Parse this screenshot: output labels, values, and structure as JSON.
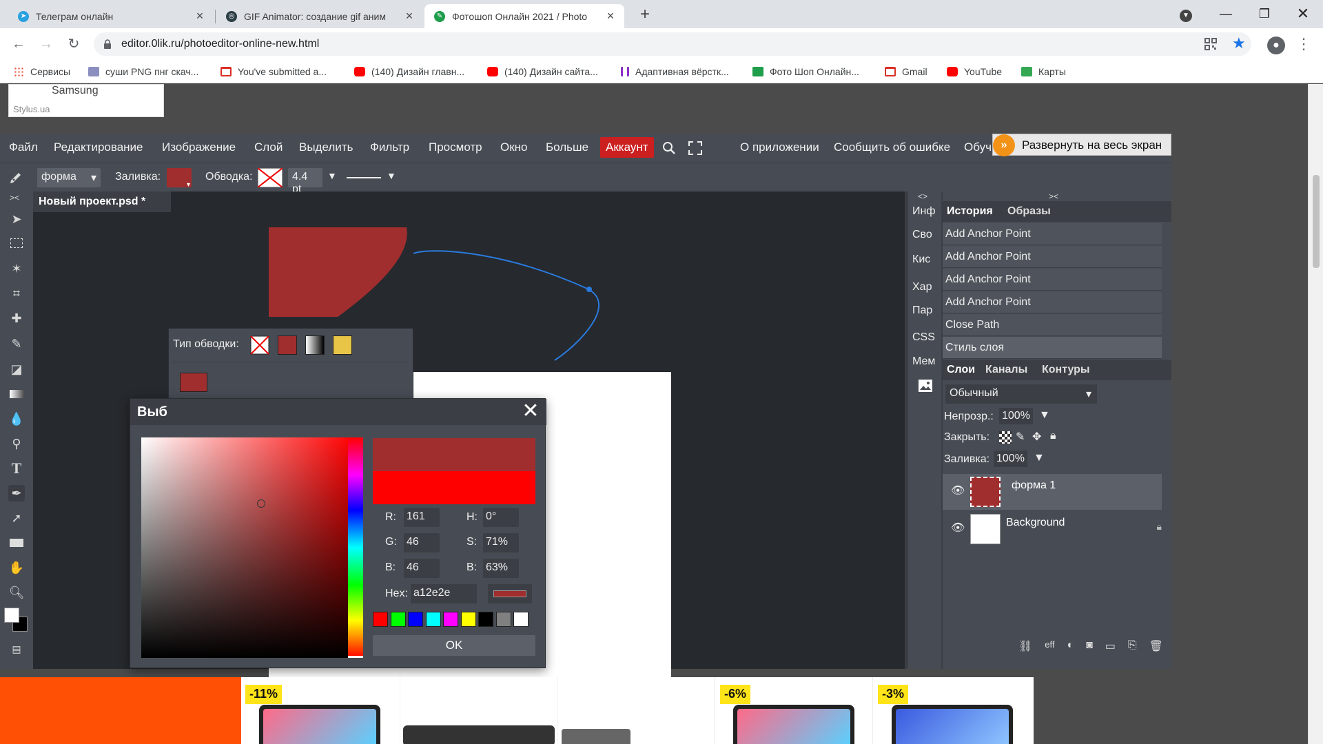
{
  "browser": {
    "tabs": [
      {
        "label": "Телеграм онлайн",
        "icon": "telegram-icon",
        "color": "#2aa1e0"
      },
      {
        "label": "GIF Animator: создание gif аним",
        "icon": "gif-animator-icon",
        "color": "#2b3d45"
      },
      {
        "label": "Фотошоп Онлайн 2021 / Photo",
        "icon": "photopea-icon",
        "color": "#1e9d4a"
      }
    ],
    "url": "editor.0lik.ru/photoeditor-online-new.html",
    "bookmarks": [
      {
        "label": "Сервисы",
        "icon": "apps-grid-icon",
        "color": "#1a73e8"
      },
      {
        "label": "суши PNG пнг скач...",
        "icon": "png-site-icon",
        "color": "#8a8fbf"
      },
      {
        "label": "You've submitted a...",
        "icon": "gmail-icon",
        "color": "#d93025"
      },
      {
        "label": "(140) Дизайн главн...",
        "icon": "youtube-icon",
        "color": "#ff0000"
      },
      {
        "label": "(140) Дизайн сайта...",
        "icon": "youtube-icon",
        "color": "#ff0000"
      },
      {
        "label": "Адаптивная вёрстк...",
        "icon": "html-academy-icon",
        "color": "#8b2fc9"
      },
      {
        "label": "Фото Шоп Онлайн...",
        "icon": "photopea-icon",
        "color": "#1e9d4a"
      },
      {
        "label": "Gmail",
        "icon": "gmail-icon",
        "color": "#d93025"
      },
      {
        "label": "YouTube",
        "icon": "youtube-icon",
        "color": "#ff0000"
      },
      {
        "label": "Карты",
        "icon": "maps-icon",
        "color": "#34a853"
      }
    ]
  },
  "ad_top": {
    "brand": "Samsung",
    "site": "Stylus.ua"
  },
  "app": {
    "menu": [
      "Файл",
      "Редактирование",
      "Изображение",
      "Слой",
      "Выделить",
      "Фильтр",
      "Просмотр",
      "Окно",
      "Больше"
    ],
    "account": "Аккаунт",
    "menu_right": [
      "О приложении",
      "Сообщить об ошибке",
      "Обуч"
    ],
    "expand": "Развернуть на весь экран",
    "options": {
      "shape_mode": "форма",
      "fill_label": "Заливка:",
      "stroke_label": "Обводка:",
      "stroke_width": "4.4 pt"
    },
    "doc_tab": "Новый проект.psd *",
    "stroke_popup": {
      "label": "Тип обводки:",
      "swatches": [
        "#a12e2e",
        "#ff0000",
        "#00ff00",
        "#0000ff",
        "#00ffff",
        "#ff00ff",
        "#ffff00",
        "#000000",
        "#808080",
        "#ffffff"
      ]
    },
    "color_dialog": {
      "title": "Выб",
      "r": "161",
      "g": "46",
      "b": "46",
      "h": "0°",
      "s": "71%",
      "bv": "63%",
      "hex_label": "Hex:",
      "hex": "a12e2e",
      "ok": "OK",
      "new_color": "#a12e2e",
      "old_color": "#ff0000",
      "swatches": [
        "#ff0000",
        "#00ff00",
        "#0000ff",
        "#00ffff",
        "#ff00ff",
        "#ffff00",
        "#000000",
        "#808080",
        "#ffffff"
      ]
    },
    "info_items": [
      "Инф",
      "Сво",
      "Кис",
      "Хар",
      "Пар",
      "CSS",
      "Мем"
    ],
    "history_tabs": [
      "История",
      "Образы"
    ],
    "history": [
      "Add Anchor Point",
      "Add Anchor Point",
      "Add Anchor Point",
      "Add Anchor Point",
      "Close Path",
      "Стиль слоя"
    ],
    "layer_tabs": [
      "Слои",
      "Каналы",
      "Контуры"
    ],
    "blend_mode": "Обычный",
    "opacity_label": "Непрозр.:",
    "opacity": "100%",
    "lock_label": "Закрыть:",
    "fill_label": "Заливка:",
    "fill": "100%",
    "layers": [
      "форма 1",
      "Background"
    ]
  },
  "ads_bottom": {
    "discounts": [
      "-11%",
      "-6%",
      "-3%"
    ]
  }
}
